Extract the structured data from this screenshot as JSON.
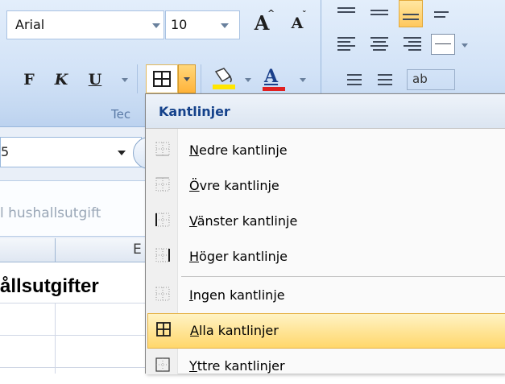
{
  "ribbon": {
    "font_name": "Arial",
    "font_size": "10",
    "grow_font_label": "A",
    "shrink_font_label": "A",
    "bold_label": "F",
    "italic_label": "K",
    "underline_label": "U",
    "font_color_label": "A",
    "group_label": "Tec",
    "font_color_hex": "#e02020",
    "fill_color_hex": "#ffe600"
  },
  "sheet": {
    "namebox_value": "5",
    "formula_text": "l hushallsutgift",
    "column_letter": "E",
    "cell_title": "ållsutgifter"
  },
  "menu": {
    "header": "Kantlinjer",
    "items": [
      {
        "accel": "N",
        "rest": "edre kantlinje",
        "icon": "bottom-border-icon"
      },
      {
        "accel": "Ö",
        "rest": "vre kantlinje",
        "icon": "top-border-icon"
      },
      {
        "accel": "V",
        "rest": "änster kantlinje",
        "icon": "left-border-icon"
      },
      {
        "accel": "H",
        "rest": "öger kantlinje",
        "icon": "right-border-icon"
      },
      {
        "accel": "I",
        "rest": "ngen kantlinje",
        "icon": "no-border-icon"
      },
      {
        "accel": "A",
        "rest": "lla kantlinjer",
        "icon": "all-borders-icon"
      },
      {
        "accel": "Y",
        "rest": "ttre kantlinjer",
        "icon": "outside-borders-icon"
      }
    ],
    "active_index": 5
  }
}
